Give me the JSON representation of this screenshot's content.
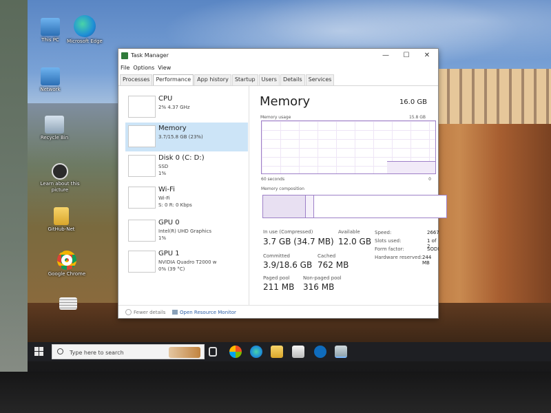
{
  "desktop": {
    "icons": [
      {
        "label": "This PC"
      },
      {
        "label": "Microsoft Edge"
      },
      {
        "label": "Network"
      },
      {
        "label": "Recycle Bin"
      },
      {
        "label": "Learn about this picture"
      },
      {
        "label": "GitHub-Net"
      },
      {
        "label": "Google Chrome"
      },
      {
        "label": ""
      }
    ]
  },
  "window": {
    "title": "Task Manager",
    "minimize": "—",
    "maximize": "☐",
    "close": "✕"
  },
  "menu": [
    "File",
    "Options",
    "View"
  ],
  "tabs": [
    "Processes",
    "Performance",
    "App history",
    "Startup",
    "Users",
    "Details",
    "Services"
  ],
  "active_tab": "Performance",
  "resources": [
    {
      "name": "CPU",
      "sub1": "2% 4.37 GHz",
      "sub2": ""
    },
    {
      "name": "Memory",
      "sub1": "3.7/15.8 GB (23%)",
      "sub2": ""
    },
    {
      "name": "Disk 0 (C: D:)",
      "sub1": "SSD",
      "sub2": "1%"
    },
    {
      "name": "Wi-Fi",
      "sub1": "Wi-Fi",
      "sub2": "S: 0 R: 0 Kbps"
    },
    {
      "name": "GPU 0",
      "sub1": "Intel(R) UHD Graphics",
      "sub2": "1%"
    },
    {
      "name": "GPU 1",
      "sub1": "NVIDIA Quadro T2000 w",
      "sub2": "0% (39 °C)"
    }
  ],
  "memory": {
    "title": "Memory",
    "total": "16.0 GB",
    "usage_label": "Memory usage",
    "usage_max": "15.8 GB",
    "seconds_label": "60 seconds",
    "seconds_zero": "0",
    "composition_label": "Memory composition",
    "stats": {
      "in_use_label": "In use (Compressed)",
      "in_use_value": "3.7 GB (34.7 MB)",
      "available_label": "Available",
      "available_value": "12.0 GB",
      "committed_label": "Committed",
      "committed_value": "3.9/18.6 GB",
      "cached_label": "Cached",
      "cached_value": "762 MB",
      "paged_label": "Paged pool",
      "paged_value": "211 MB",
      "nonpaged_label": "Non-paged pool",
      "nonpaged_value": "316 MB"
    },
    "details": {
      "speed_label": "Speed:",
      "speed_value": "2667",
      "slots_label": "Slots used:",
      "slots_value": "1 of 2",
      "form_label": "Form factor:",
      "form_value": "SODI",
      "reserved_label": "Hardware reserved:",
      "reserved_value": "244 MB"
    }
  },
  "footer": {
    "fewer_details": "Fewer details",
    "open_monitor": "Open Resource Monitor"
  },
  "taskbar": {
    "search_placeholder": "Type here to search"
  },
  "colors": {
    "accent_purple": "#9d7fc7",
    "selected_item": "#cce4f7",
    "link_blue": "#2d5fa7"
  }
}
